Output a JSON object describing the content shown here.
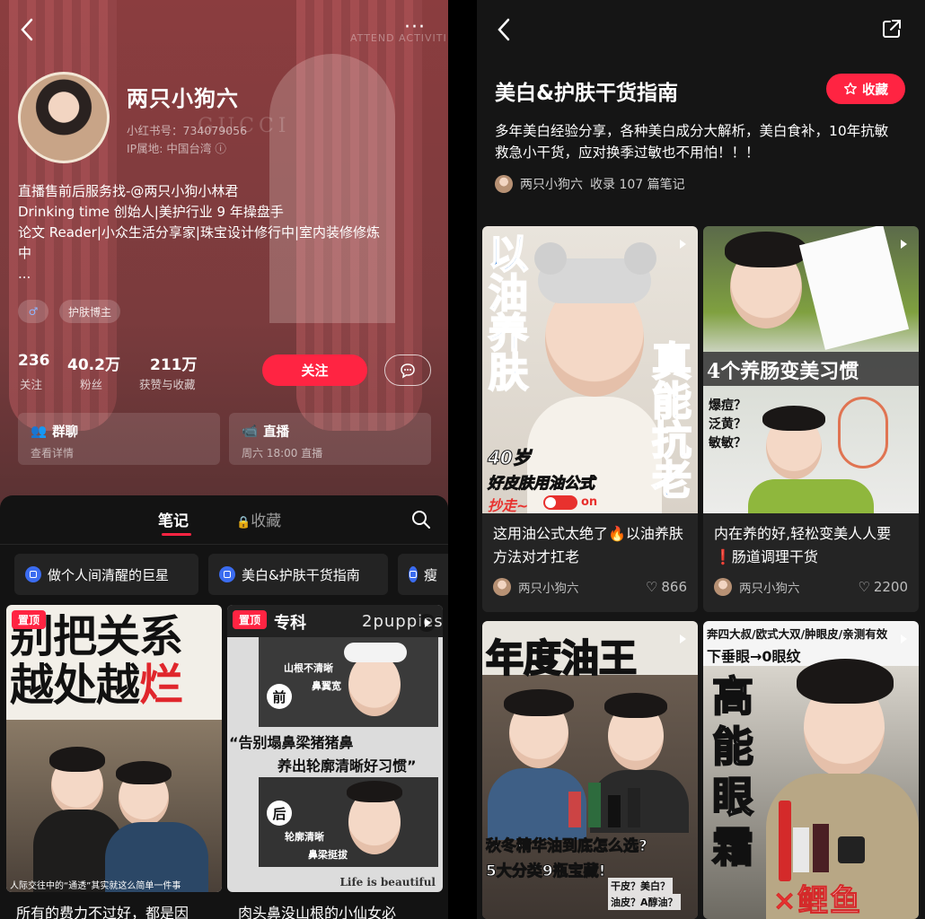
{
  "left": {
    "header": {
      "back_icon": "chevron-left-icon",
      "more_label": "···",
      "watermark_text": "ATTEND ACTIVITI",
      "brand_text": "GUCCI"
    },
    "profile": {
      "name": "两只小狗六",
      "red_id": "小红书号：734079056",
      "ip": "IP属地: 中国台湾",
      "bio": [
        "直播售前后服务找-@两只小狗小林君",
        "Drinking time 创始人|美护行业 9 年操盘手",
        "论文 Reader|小众生活分享家|珠宝设计修行中|室内装修修炼",
        "中",
        "..."
      ],
      "tags": [
        "♂",
        "护肤博主"
      ]
    },
    "stats": [
      {
        "value": "236",
        "label": "关注"
      },
      {
        "value": "40.2万",
        "label": "粉丝"
      },
      {
        "value": "211万",
        "label": "获赞与收藏"
      }
    ],
    "follow_label": "关注",
    "cards": [
      {
        "title": "群聊",
        "subtitle": "查看详情"
      },
      {
        "title": "直播",
        "subtitle": "周六 18:00 直播"
      }
    ],
    "tabs": {
      "notes": "笔记",
      "collect": "收藏"
    },
    "chips": [
      "做个人间清醒的巨星",
      "美白&护肤干货指南",
      "瘦"
    ],
    "notes": [
      {
        "pin": "置顶",
        "headline_line1": "别把关系",
        "headline_line2a": "越处越",
        "headline_line2b": "烂",
        "subtitle": "人际交往中的“通透”其实就这么简单一件事",
        "caption": "所有的费力不过好，都是因"
      },
      {
        "pin": "置顶",
        "corner_text": "专科",
        "watermark": "2puppies",
        "label1": "山根不清晰",
        "label2": "鼻翼宽",
        "before": "前",
        "quote1": "“告别塌鼻梁猪猪鼻",
        "quote2": "养出轮廓清晰好习惯”",
        "after": "后",
        "label3": "轮廓清晰",
        "label4": "鼻梁挺拔",
        "footer": "Life is beautiful",
        "caption": "肉头鼻没山根的小仙女必"
      }
    ]
  },
  "right": {
    "header": {
      "back_icon": "chevron-left-icon",
      "share_icon": "share-icon"
    },
    "title": "美白&护肤干货指南",
    "fav_label": "收藏",
    "description": "多年美白经验分享，各种美白成分大解析，美白食补，10年抗敏救急小干货，应对换季过敏也不用怕！！！",
    "author": "两只小狗六",
    "count": "收录 107 篇笔记",
    "notes": [
      {
        "vert_left": "以油养肤",
        "vert_right": "真能抗老",
        "age": "40岁",
        "formula": "好皮肤用油公式",
        "copy": "抄走~",
        "toggle": "on",
        "caption": "这用油公式太绝了🔥以油养肤方法对才扛老",
        "author": "两只小狗六",
        "likes": "866"
      },
      {
        "banner": "4个养肠变美习惯",
        "q1": "爆痘？",
        "q2": "泛黄？",
        "q3": "敏敏？",
        "caption": "内在养的好,轻松变美人人要❗肠道调理干货",
        "author": "两只小狗六",
        "likes": "2200"
      },
      {
        "banner": "年度油王",
        "line1": "秋冬精华油到底怎么选?",
        "line2": "5大分类9瓶宝藏!",
        "q1": "干皮？美白？",
        "q2": "油皮？A醇油？"
      },
      {
        "top": "奔四大叔/欧式大双/肿眼皮/亲测有效",
        "sub": "下垂眼→0眼纹",
        "vert": "高能眼霜"
      }
    ],
    "watermark": "鲤鱼"
  },
  "colors": {
    "accent": "#ff2442",
    "chip_icon": "#3b6cf0"
  }
}
